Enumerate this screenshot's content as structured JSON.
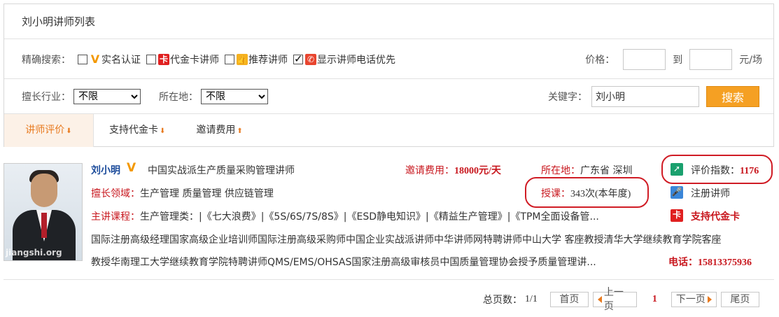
{
  "panel": {
    "title": "刘小明讲师列表"
  },
  "filters": {
    "label": "精确搜索：",
    "options": [
      {
        "label": "实名认证",
        "icon": "v-verified-icon",
        "checked": false
      },
      {
        "label": "代金卡讲师",
        "icon": "voucher-card-icon",
        "checked": false
      },
      {
        "label": "推荐讲师",
        "icon": "thumbs-up-icon",
        "checked": false
      },
      {
        "label": "显示讲师电话优先",
        "icon": "phone-icon",
        "checked": true
      }
    ],
    "price_label": "价格：",
    "price_to": "到",
    "price_unit": "元/场",
    "industry_label": "擅长行业：",
    "industry_value": "不限",
    "location_label": "所在地：",
    "location_value": "不限",
    "keyword_label": "关键字：",
    "keyword_value": "刘小明",
    "search_label": "搜索"
  },
  "sort_tabs": [
    {
      "label": "讲师评价",
      "arrow": "down",
      "active": true
    },
    {
      "label": "支持代金卡",
      "arrow": "down",
      "active": false
    },
    {
      "label": "邀请费用",
      "arrow": "up",
      "active": false
    }
  ],
  "result": {
    "name": "刘小明",
    "headline": "中国实战派生产质量采购管理讲师",
    "fee_label": "邀请费用：",
    "fee_value": "18000元/天",
    "location_label": "所在地：",
    "location_value": "广东省 深圳",
    "rating_label": "评价指数：",
    "rating_value": "1176",
    "field_label": "擅长领域：",
    "field_value": "生产管理 质量管理 供应链管理",
    "lessons_label": "授课：",
    "lessons_value": "343次(本年度)",
    "register_label": "注册讲师",
    "courses_label": "主讲课程：",
    "courses_value": "生产管理类：|《七大浪费》|《5S/6S/7S/8S》|《ESD静电知识》|《精益生产管理》|《TPM全面设备管...",
    "voucher_label": "支持代金卡",
    "bio_line1": "国际注册高级经理国家高级企业培训师国际注册高级采购师中国企业实战派讲师中华讲师网特聘讲师中山大学 客座教授清华大学继续教育学院客座",
    "bio_line2": "教授华南理工大学继续教育学院特聘讲师QMS/EMS/OHSAS国家注册高级审核员中国质量管理协会授予质量管理讲...",
    "phone_label": "电话：",
    "phone_value": "15813375936",
    "photo_watermark": "jiangshi.org"
  },
  "pager": {
    "total_label": "总页数：",
    "total_value": "1/1",
    "first": "首页",
    "prev": "上一页",
    "current": "1",
    "next": "下一页",
    "last": "尾页"
  },
  "colors": {
    "accent": "#f5a023",
    "red": "#c8171e",
    "name_blue": "#1a4a9a",
    "ring": "#d01c25"
  }
}
